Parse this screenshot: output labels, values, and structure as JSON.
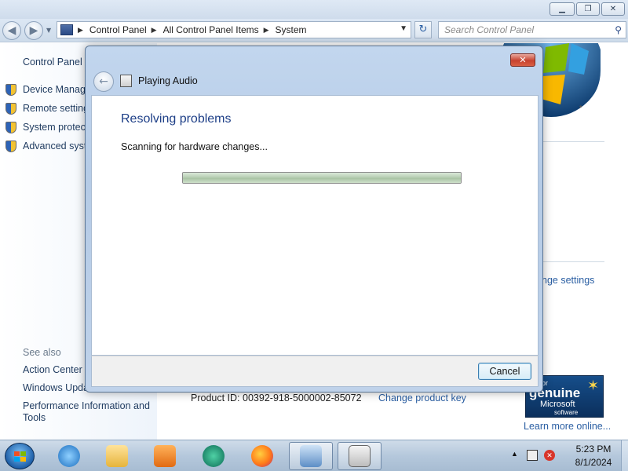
{
  "window": {
    "caption_buttons": [
      "minimize",
      "restore",
      "close"
    ]
  },
  "navigation": {
    "breadcrumb": [
      "Control Panel",
      "All Control Panel Items",
      "System"
    ],
    "search_placeholder": "Search Control Panel"
  },
  "sidebar": {
    "home": "Control Panel H",
    "links": [
      "Device Manage",
      "Remote setting",
      "System protect",
      "Advanced syste"
    ],
    "see_also_title": "See also",
    "see_also": [
      "Action Center",
      "Windows Upda",
      "Performance Information and",
      "Tools"
    ]
  },
  "main": {
    "change_settings": "nge settings",
    "product_id_label": "Product ID:",
    "product_id_value": "00392-918-5000002-85072",
    "change_product_key": "Change product key",
    "genuine_badge": {
      "line1": "sk for",
      "line2": "genuine",
      "line3": "Microsoft",
      "line4": "software"
    },
    "learn_more": "Learn more online..."
  },
  "dialog": {
    "title": "Playing Audio",
    "heading": "Resolving problems",
    "status": "Scanning for hardware changes...",
    "progress": 1.0,
    "cancel_label": "Cancel",
    "close_glyph": "✕"
  },
  "taskbar": {
    "apps": [
      "internet-explorer",
      "file-explorer",
      "media-player",
      "app-green",
      "firefox",
      "control-panel",
      "troubleshooter"
    ],
    "time": "5:23 PM",
    "date": "8/1/2024"
  },
  "colors": {
    "link": "#2b5fa3",
    "heading": "#1e3f87",
    "taskbar": "#b5c8dc"
  }
}
